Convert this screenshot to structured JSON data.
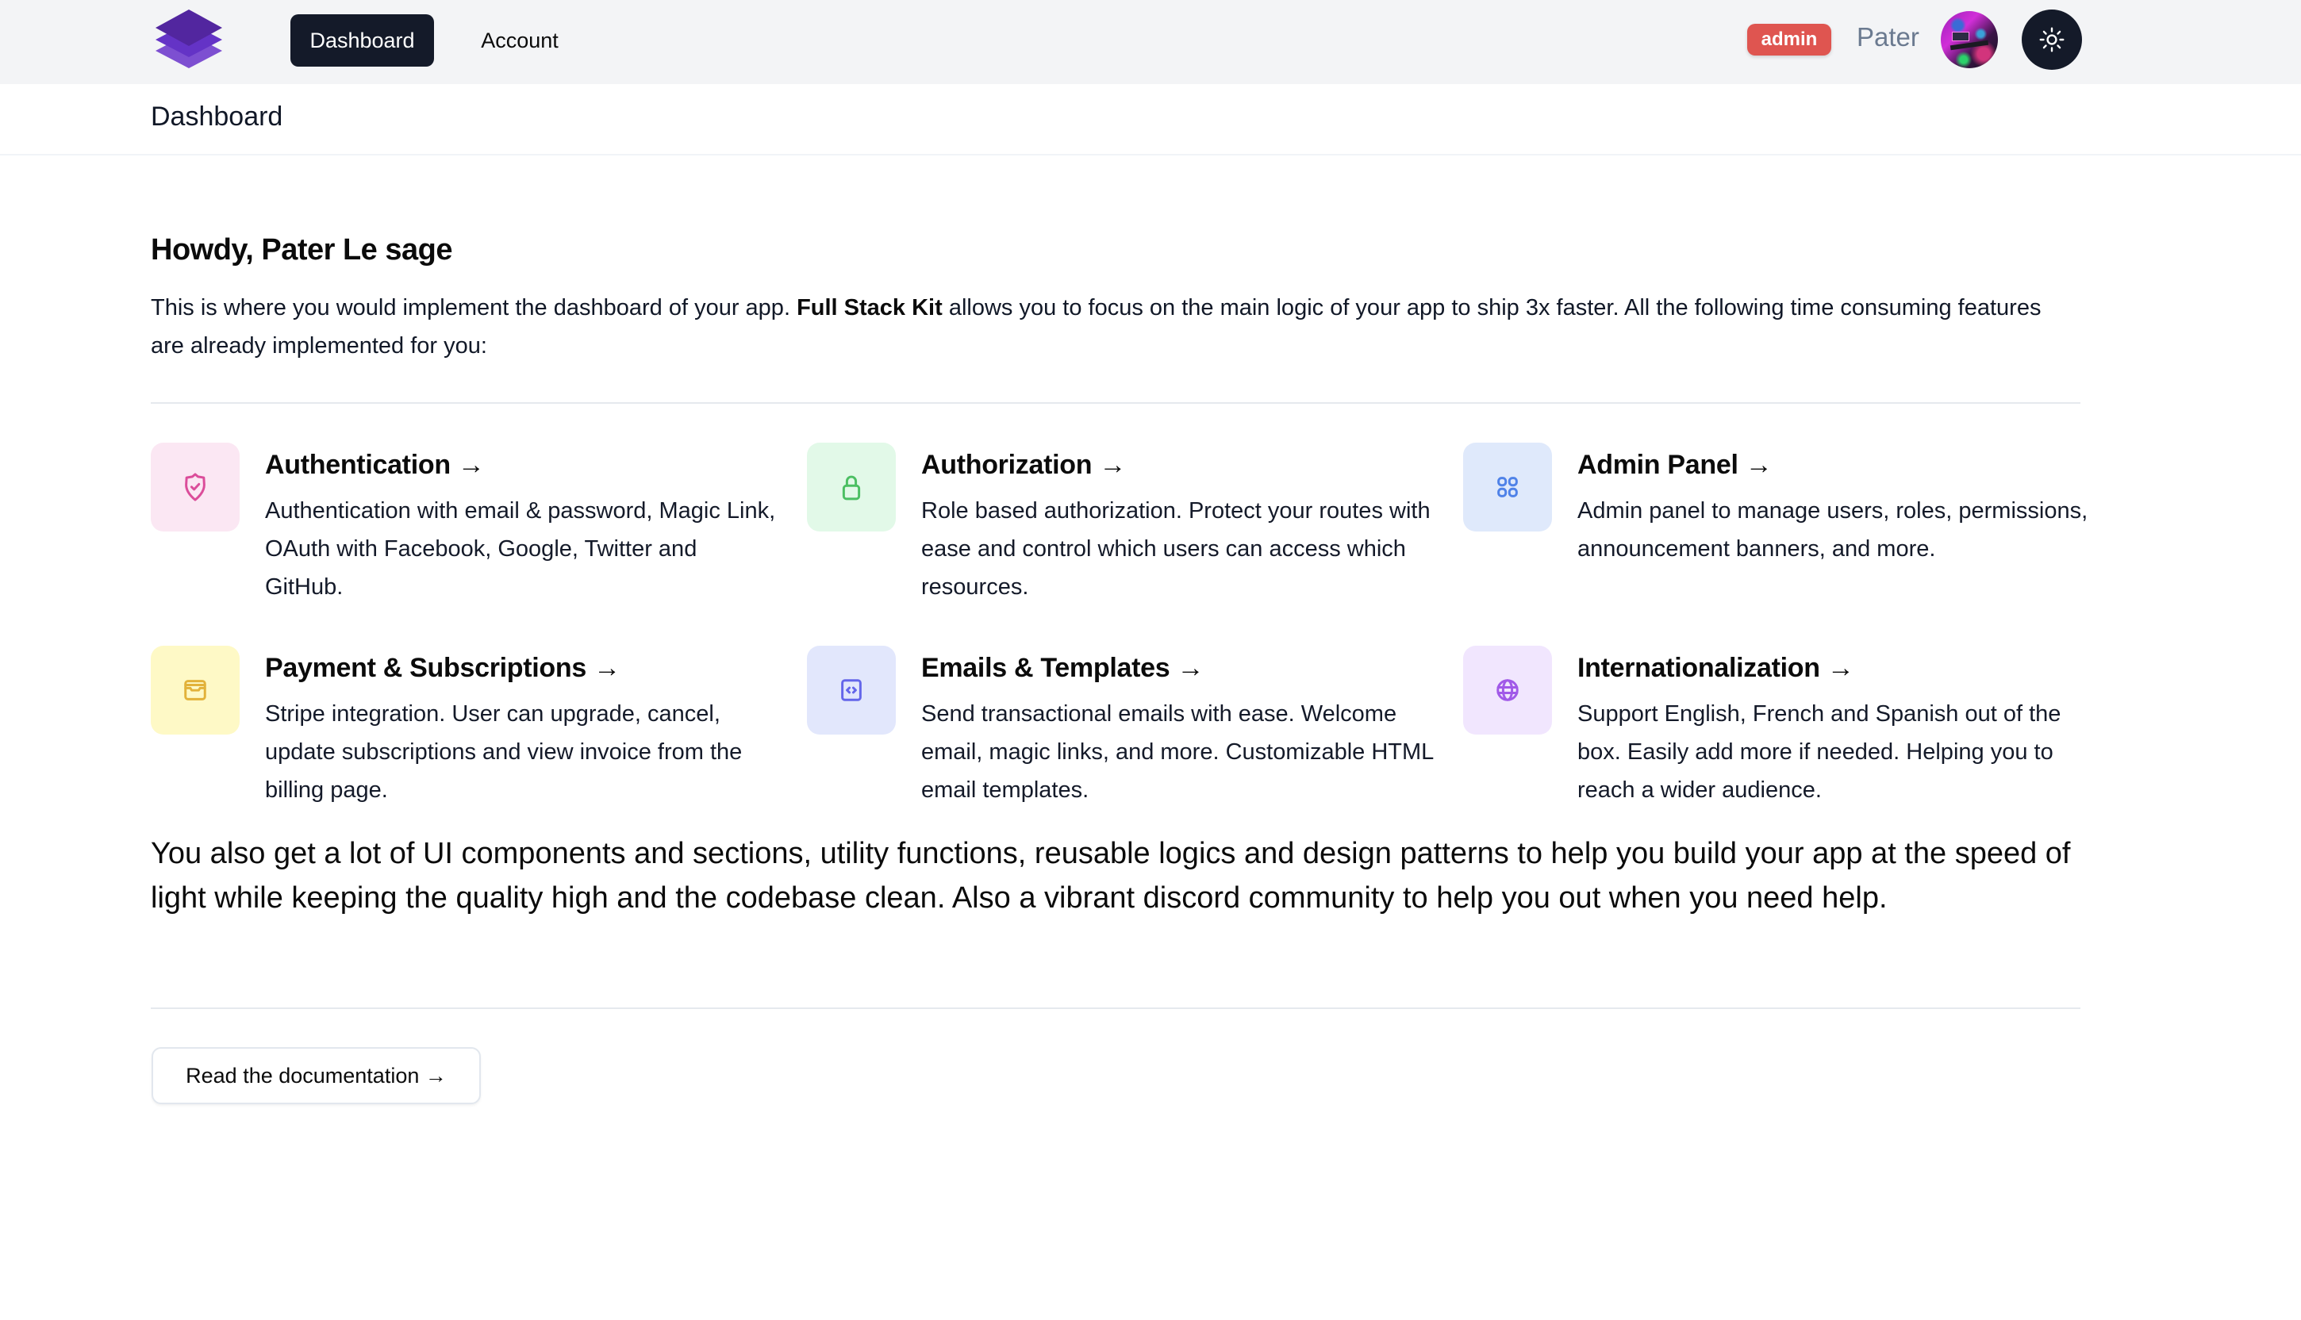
{
  "nav": {
    "logo_alt": "stacked-layers logo",
    "items": [
      {
        "label": "Dashboard",
        "active": true
      },
      {
        "label": "Account",
        "active": false
      }
    ],
    "role_badge": "admin",
    "username": "Pater",
    "avatar_icon": "user-avatar-photo",
    "theme_toggle_icon": "sun-icon"
  },
  "subheader": {
    "title": "Dashboard"
  },
  "main": {
    "greeting": "Howdy, Pater Le sage",
    "intro": {
      "before": "This is where you would implement the dashboard of your app. ",
      "brand": "Full Stack Kit",
      "after": " allows you to focus on the main logic of your app to ship 3x faster. All the following time consuming features are already implemented for you:"
    },
    "features": [
      {
        "title": "Authentication →",
        "description": "Authentication with email & password, Magic Link, OAuth with Facebook, Google, Twitter and GitHub.",
        "icon": "shield-check-icon",
        "icon_color": "#db4d9a",
        "bg_color": "#fbe7f3"
      },
      {
        "title": "Authorization →",
        "description": "Role based authorization. Protect your routes with ease and control which users can access which resources.",
        "icon": "lock-icon",
        "icon_color": "#4cbf63",
        "bg_color": "#e2f9e8"
      },
      {
        "title": "Admin Panel →",
        "description": "Admin panel to manage users, roles, permissions, announcement banners, and more.",
        "icon": "grid-icon",
        "icon_color": "#4f82e8",
        "bg_color": "#dfe9fb"
      },
      {
        "title": "Payment & Subscriptions →",
        "description": "Stripe integration. User can upgrade, cancel, update subscriptions and view invoice from the billing page.",
        "icon": "wallet-icon",
        "icon_color": "#e2b23a",
        "bg_color": "#fef9c6"
      },
      {
        "title": "Emails & Templates →",
        "description": "Send transactional emails with ease. Welcome email, magic links, and more. Customizable HTML email templates.",
        "icon": "code-icon",
        "icon_color": "#6466ea",
        "bg_color": "#e2e7fc"
      },
      {
        "title": "Internationalization →",
        "description": "Support English, French and Spanish out of the box. Easily add more if needed. Helping you to reach a wider audience.",
        "icon": "globe-icon",
        "icon_color": "#a159e8",
        "bg_color": "#f1e6fe"
      }
    ],
    "outro": "You also get a lot of UI components and sections, utility functions, reusable logics and design patterns to help you build your app at the speed of light while keeping the quality high and the codebase clean. Also a vibrant discord community to help you out when you need help.",
    "docs_button": "Read the documentation →"
  }
}
